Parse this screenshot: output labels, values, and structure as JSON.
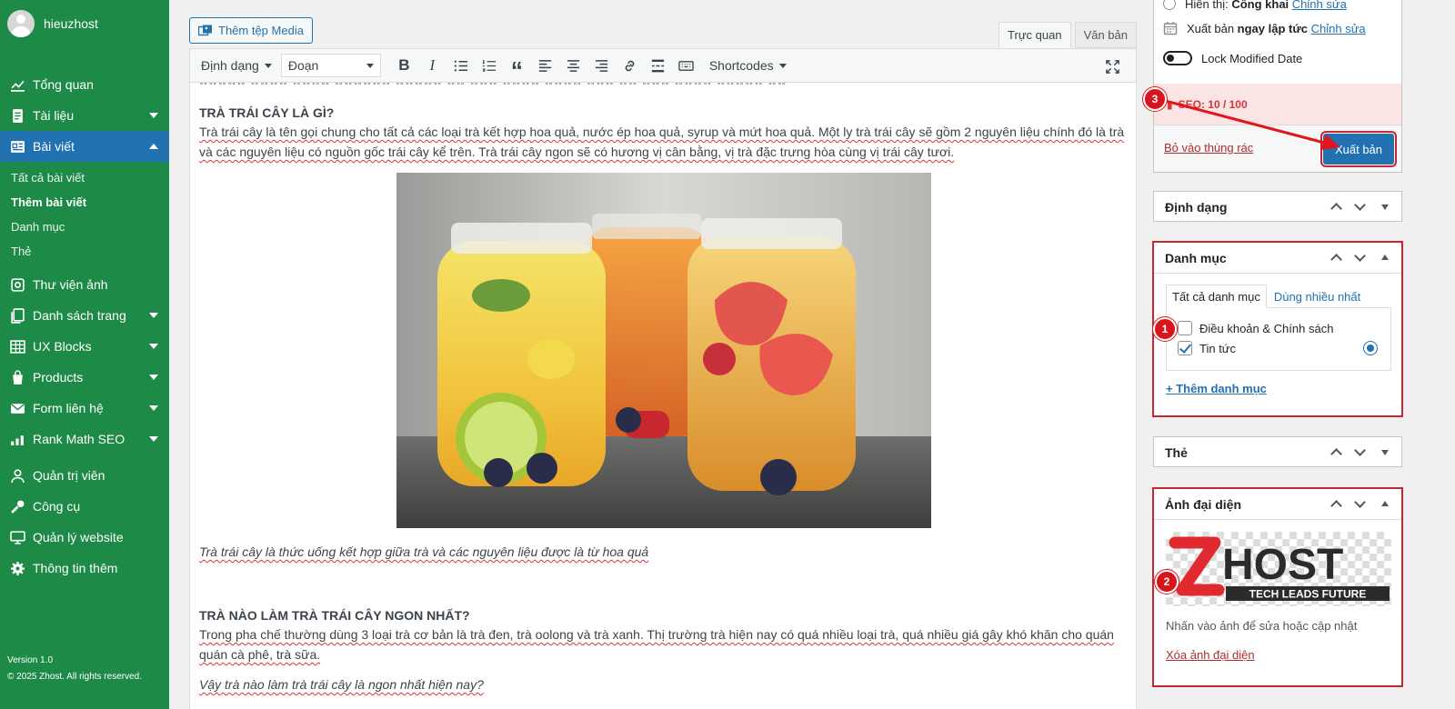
{
  "sidebar": {
    "username": "hieuzhost",
    "items": [
      {
        "label": "Tổng quan",
        "icon": "chart-line-icon"
      },
      {
        "label": "Tài liệu",
        "icon": "document-icon"
      },
      {
        "label": "Bài viết",
        "icon": "posts-icon"
      },
      {
        "label": "Thư viện ảnh",
        "icon": "gallery-icon"
      },
      {
        "label": "Danh sách trang",
        "icon": "pages-icon"
      },
      {
        "label": "UX Blocks",
        "icon": "blocks-icon"
      },
      {
        "label": "Products",
        "icon": "products-icon"
      },
      {
        "label": "Form liên hệ",
        "icon": "mail-icon"
      },
      {
        "label": "Rank Math SEO",
        "icon": "rankmath-icon"
      },
      {
        "label": "Quản trị viên",
        "icon": "user-icon"
      },
      {
        "label": "Công cụ",
        "icon": "wrench-icon"
      },
      {
        "label": "Quản lý website",
        "icon": "monitor-icon"
      },
      {
        "label": "Thông tin thêm",
        "icon": "gear-icon"
      }
    ],
    "subitems": [
      "Tất cả bài viết",
      "Thêm bài viết",
      "Danh mục",
      "Thẻ"
    ],
    "version": "Version 1.0",
    "copyright": "© 2025 Zhost. All rights reserved."
  },
  "editor": {
    "media_button": "Thêm tệp Media",
    "tab_visual": "Trực quan",
    "tab_text": "Văn bản",
    "format_dropdown": "Định dạng",
    "paragraph_select": "Đoạn",
    "shortcodes": "Shortcodes",
    "heading1": "TRÀ TRÁI CÂY LÀ GÌ?",
    "para1": "Trà trái cây là tên gọi chung cho tất cả các loại trà kết hợp hoa quả, nước ép hoa quả, syrup và mứt hoa quả. Một ly trà trái cây sẽ gồm 2 nguyên liệu chính đó là trà và các nguyên liệu có nguồn gốc trái cây kể trên. Trà trái cây ngon sẽ có hương vị cân bằng, vị trà đặc trưng hòa cùng vị trái cây tươi.",
    "caption": "Trà trái cây là thức uống kết hợp giữa trà và các nguyên liệu được là từ hoa quả",
    "heading2": "TRÀ NÀO LÀM TRÀ TRÁI CÂY NGON NHẤT?",
    "para2": "Trong pha chế thường dùng 3 loại trà cơ bản là trà đen, trà oolong và trà xanh. Thị trường trà hiện nay có quá nhiều loại trà, quá nhiều giá gây khó khăn cho quán quán cà phê, trà sữa.",
    "para3": "Vậy trà nào làm trà trái cây là ngon nhất hiện nay?"
  },
  "publish": {
    "visibility_label": "Hiển thị:",
    "visibility_value": "Công khai",
    "visibility_edit": "Chỉnh sửa",
    "publish_label": "Xuất bản",
    "publish_value": "ngay lập tức",
    "publish_edit": "Chỉnh sửa",
    "lock_modified": "Lock Modified Date",
    "seo": "SEO: 10 / 100",
    "trash": "Bỏ vào thùng rác",
    "publish_button": "Xuất bản"
  },
  "format_box": {
    "title": "Định dạng"
  },
  "category_box": {
    "title": "Danh mục",
    "tab_all": "Tất cả danh mục",
    "tab_popular": "Dùng nhiều nhất",
    "items": [
      "Điều khoản & Chính sách",
      "Tin tức"
    ],
    "add": "+ Thêm danh mục"
  },
  "tag_box": {
    "title": "Thẻ"
  },
  "featured_box": {
    "title": "Ảnh đại diện",
    "logo_text": "HOST",
    "logo_tagline": "TECH LEADS FUTURE",
    "hint": "Nhấn vào ảnh để sửa hoặc cập nhật",
    "remove": "Xóa ảnh đại diện"
  },
  "annotations": {
    "n1": "1",
    "n2": "2",
    "n3": "3"
  },
  "colors": {
    "sidebar": "#1e8a47",
    "accent": "#2271b1",
    "annotation": "#d8151d"
  }
}
